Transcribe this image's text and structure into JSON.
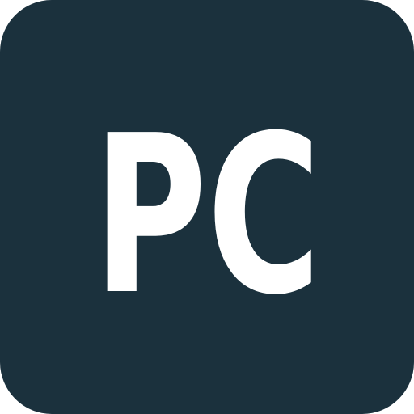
{
  "icon": {
    "semantic": "pc-platform-icon",
    "label": "PC",
    "colors": {
      "background": "#1b313d",
      "text": "#ffffff"
    }
  }
}
